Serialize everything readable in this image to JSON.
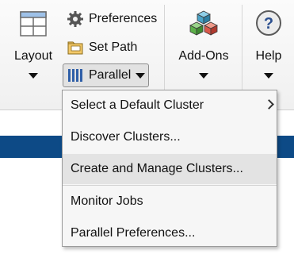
{
  "toolstrip": {
    "layout": {
      "label": "Layout",
      "icon": "layout-grid-icon"
    },
    "preferences": {
      "label": "Preferences",
      "icon": "gear-icon"
    },
    "set_path": {
      "label": "Set Path",
      "icon": "folder-path-icon"
    },
    "parallel": {
      "label": "Parallel",
      "icon": "parallel-bars-icon"
    },
    "addons": {
      "label": "Add-Ons",
      "icon": "cubes-icon"
    },
    "help": {
      "label": "Help",
      "icon": "question-icon"
    }
  },
  "parallel_menu": {
    "items": [
      {
        "label": "Select a Default Cluster",
        "has_submenu": true
      },
      {
        "label": "Discover Clusters..."
      },
      {
        "label": "Create and Manage Clusters...",
        "highlighted": true
      },
      {
        "label": "Monitor Jobs"
      },
      {
        "label": "Parallel Preferences..."
      }
    ]
  },
  "colors": {
    "band": "#0d4a86",
    "highlight": "#e3e3e3",
    "accent_blue": "#2f5fa8"
  }
}
